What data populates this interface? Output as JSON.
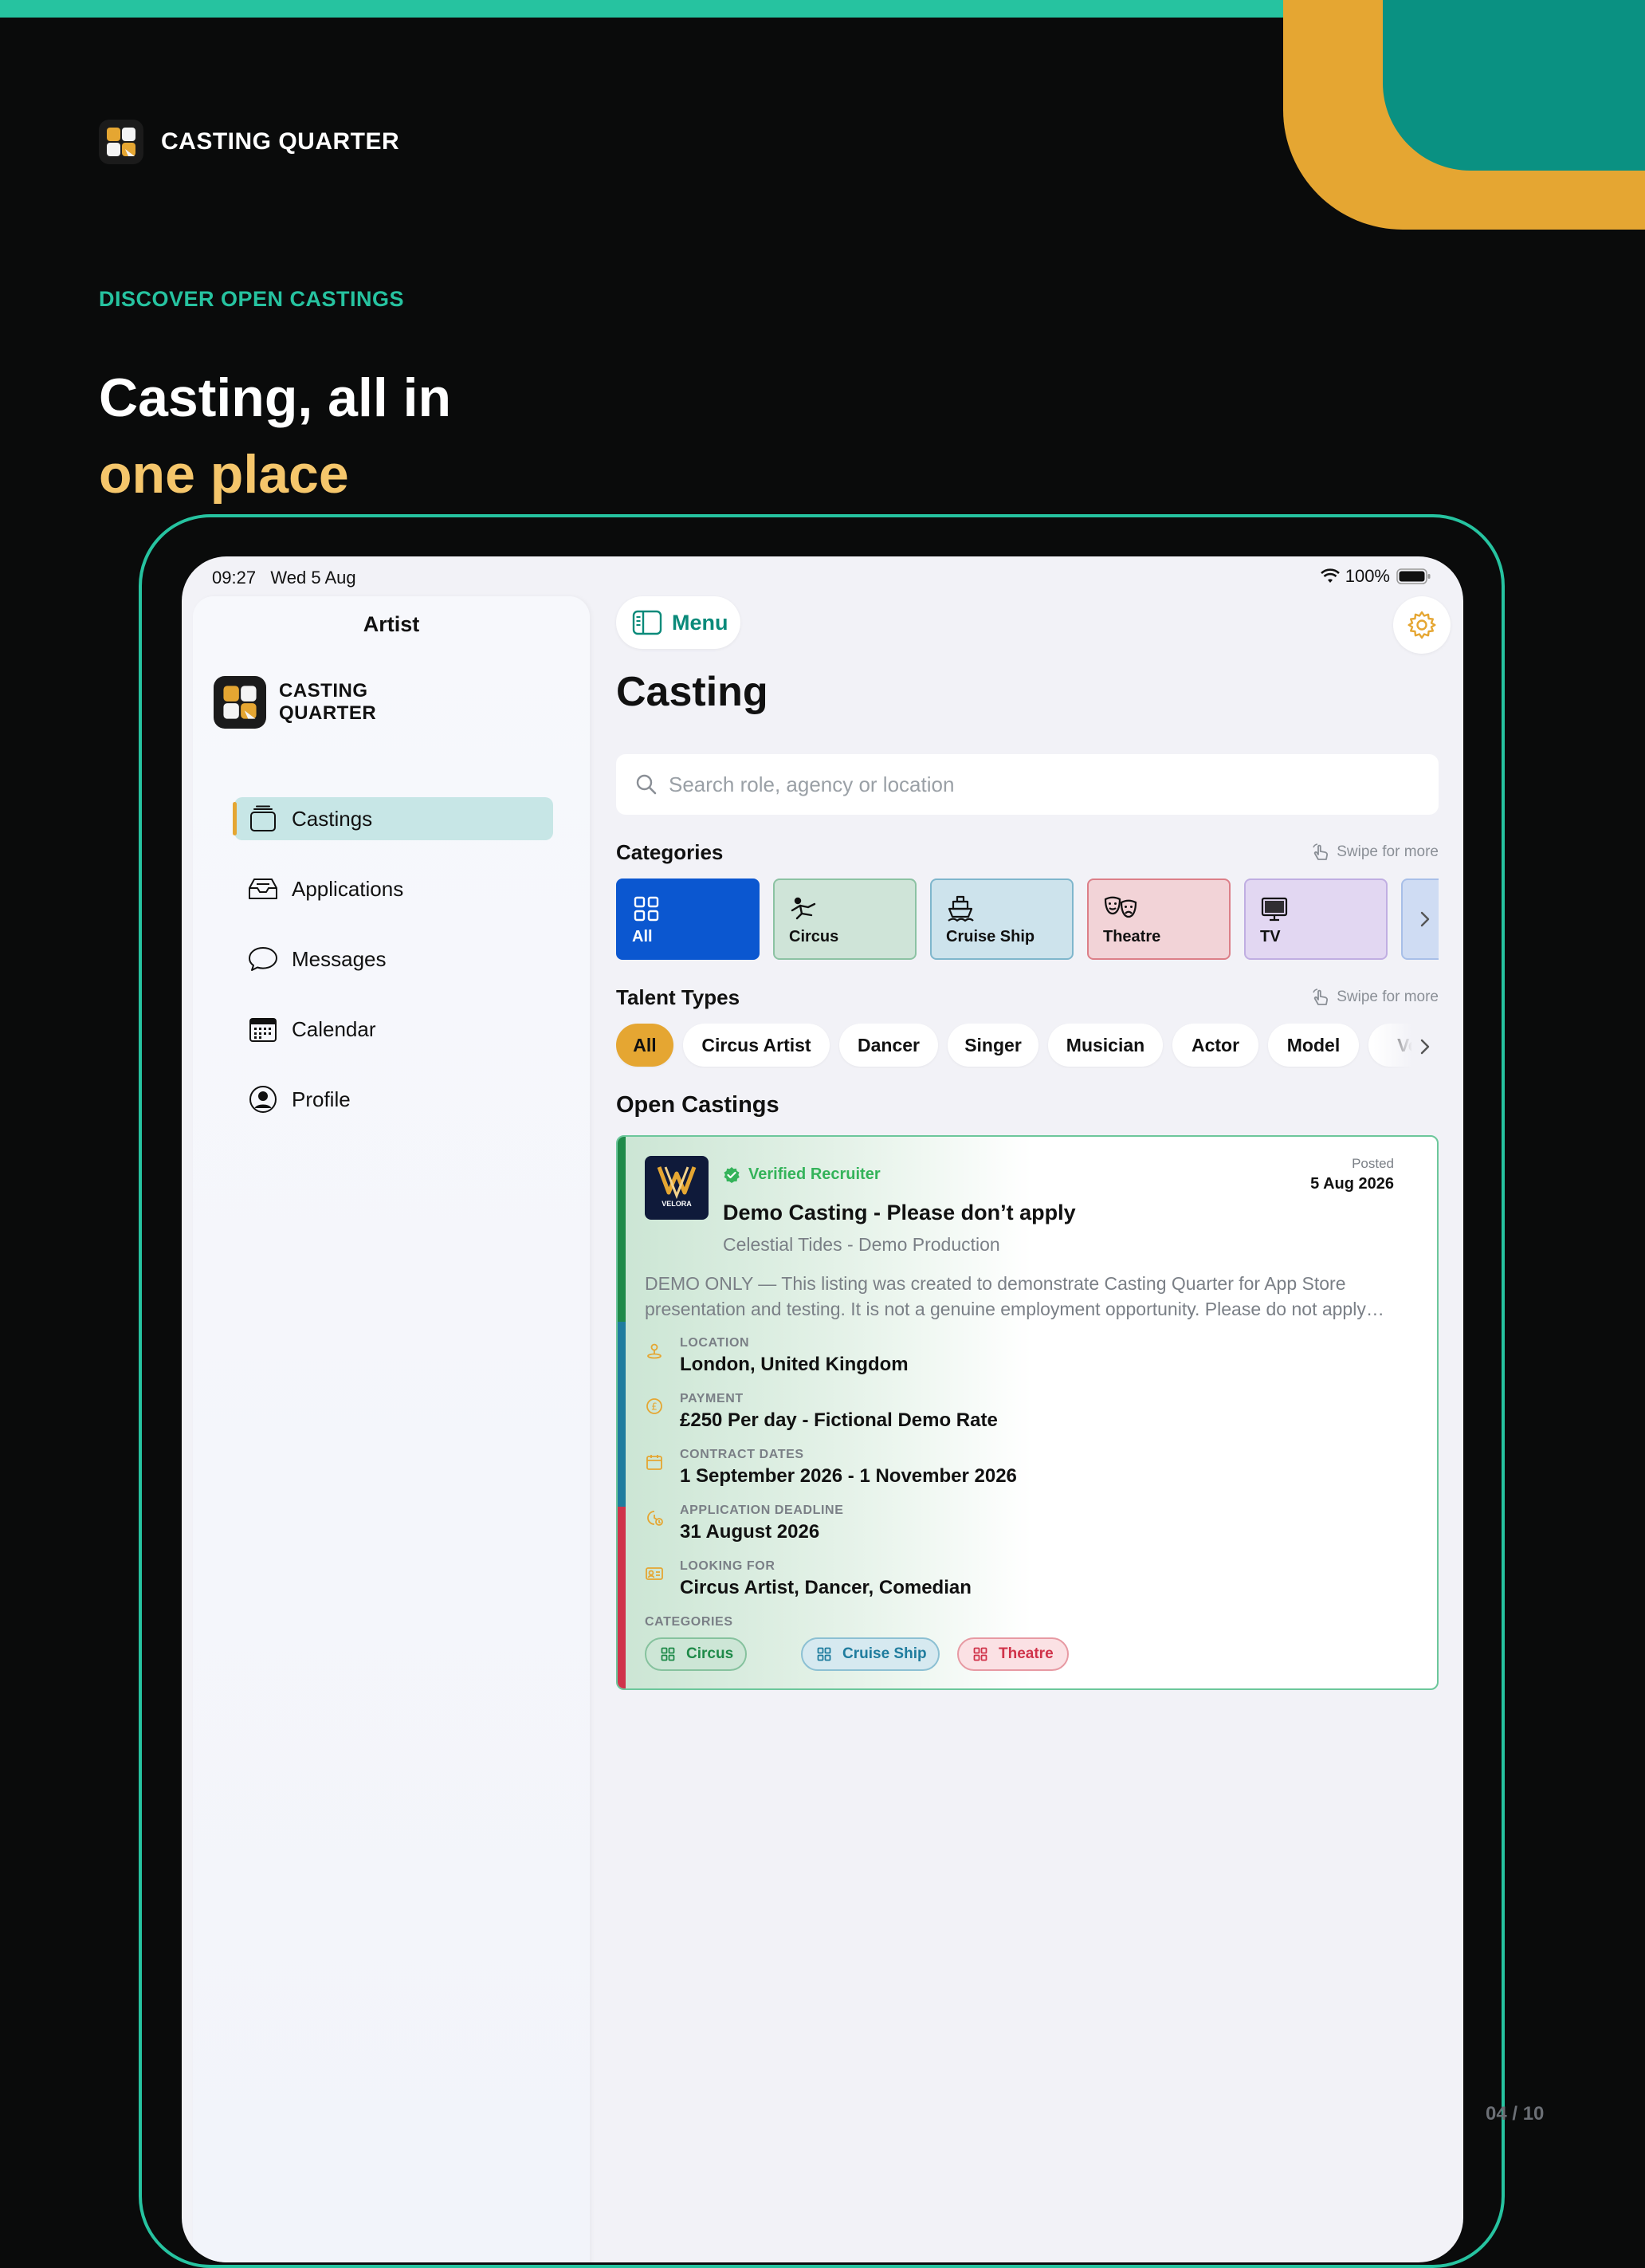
{
  "brand": {
    "name": "CASTING QUARTER"
  },
  "hero": {
    "kicker": "DISCOVER OPEN CASTINGS",
    "headline_line1": "Casting, all in",
    "headline_line2": "one place"
  },
  "pager": "04 / 10",
  "colors": {
    "accent_teal": "#26c3a0",
    "accent_orange": "#e5a632",
    "deep_teal": "#0a9182",
    "headline_yellow": "#f5c66b"
  },
  "device": {
    "status": {
      "time": "09:27",
      "date": "Wed 5 Aug",
      "battery": "100%"
    },
    "sidebar": {
      "title": "Artist",
      "logo_line1": "CASTING",
      "logo_line2": "QUARTER",
      "items": [
        {
          "label": "Castings",
          "icon": "castings-icon",
          "active": true
        },
        {
          "label": "Applications",
          "icon": "tray-icon"
        },
        {
          "label": "Messages",
          "icon": "chat-bubble-icon"
        },
        {
          "label": "Calendar",
          "icon": "calendar-icon"
        },
        {
          "label": "Profile",
          "icon": "user-circle-icon"
        }
      ]
    },
    "main": {
      "menu_label": "Menu",
      "title": "Casting",
      "search_placeholder": "Search role, agency or location",
      "categories_label": "Categories",
      "swipe_hint": "Swipe for more",
      "categories": [
        {
          "label": "All",
          "icon": "grid-icon",
          "bg": "#0b57d0",
          "border": "#0b57d0",
          "fg": "#ffffff"
        },
        {
          "label": "Circus",
          "icon": "acrobat-icon",
          "bg": "#cfe4d8",
          "border": "#8cc2a3",
          "fg": "#111111"
        },
        {
          "label": "Cruise Ship",
          "icon": "ship-icon",
          "bg": "#cde3ec",
          "border": "#7fb6cc",
          "fg": "#111111"
        },
        {
          "label": "Theatre",
          "icon": "theatre-masks-icon",
          "bg": "#f2d3d7",
          "border": "#dc7f88",
          "fg": "#111111"
        },
        {
          "label": "TV",
          "icon": "tv-icon",
          "bg": "#e2d7f2",
          "border": "#c0aee2",
          "fg": "#111111"
        }
      ],
      "talent_label": "Talent Types",
      "talent_types": [
        "All",
        "Circus Artist",
        "Dancer",
        "Singer",
        "Musician",
        "Actor",
        "Model",
        "Vo"
      ],
      "open_label": "Open Castings",
      "casting": {
        "verified": "Verified Recruiter",
        "title": "Demo Casting - Please don’t apply",
        "subtitle": "Celestial Tides - Demo Production",
        "posted_label": "Posted",
        "posted_date": "5 Aug 2026",
        "description": "DEMO ONLY — This listing was created to demonstrate Casting Quarter for App Store presentation and testing. It is not a genuine employment opportunity. Please do not apply…",
        "logo_text": "VELORA",
        "details": [
          {
            "label": "LOCATION",
            "value": "London, United Kingdom",
            "icon": "location-pin-icon"
          },
          {
            "label": "PAYMENT",
            "value": "£250 Per day - Fictional Demo Rate",
            "icon": "pound-coin-icon"
          },
          {
            "label": "CONTRACT DATES",
            "value": "1 September 2026 - 1 November 2026",
            "icon": "calendar-icon"
          },
          {
            "label": "APPLICATION DEADLINE",
            "value": "31 August 2026",
            "icon": "clock-calendar-icon"
          },
          {
            "label": "LOOKING FOR",
            "value": "Circus Artist, Dancer, Comedian",
            "icon": "id-card-icon"
          }
        ],
        "categories_label": "CATEGORIES",
        "tags": [
          {
            "label": "Circus",
            "bg": "#cde6d6",
            "border": "#86c29e",
            "fg": "#1f8a49"
          },
          {
            "label": "Cruise Ship",
            "bg": "#d6e9f0",
            "border": "#8cc0d3",
            "fg": "#1f7c9e"
          },
          {
            "label": "Theatre",
            "bg": "#fbe1e4",
            "border": "#e79aa3",
            "fg": "#d0334a"
          }
        ]
      }
    }
  }
}
